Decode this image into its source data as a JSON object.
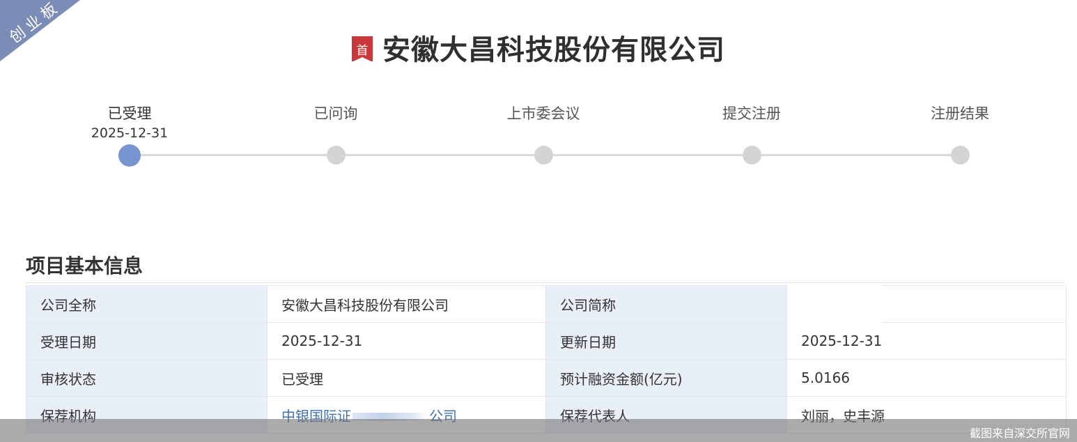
{
  "board_ribbon": "创业板",
  "header": {
    "badge": "首",
    "company_name": "安徽大昌科技股份有限公司"
  },
  "progress": {
    "steps": [
      {
        "label": "已受理",
        "date": "2025-12-31",
        "active": true
      },
      {
        "label": "已问询",
        "date": "",
        "active": false
      },
      {
        "label": "上市委会议",
        "date": "",
        "active": false
      },
      {
        "label": "提交注册",
        "date": "",
        "active": false
      },
      {
        "label": "注册结果",
        "date": "",
        "active": false
      }
    ],
    "active_color": "#7895cf",
    "inactive_color": "#d4d4d4"
  },
  "section": {
    "title": "项目基本信息"
  },
  "info_table": {
    "rows": [
      {
        "label1": "公司全称",
        "value1": "安徽大昌科技股份有限公司",
        "label2": "公司简称",
        "value2": ""
      },
      {
        "label1": "受理日期",
        "value1": "2025-12-31",
        "label2": "更新日期",
        "value2": "2025-12-31"
      },
      {
        "label1": "审核状态",
        "value1": "已受理",
        "label2": "预计融资金额(亿元)",
        "value2": "5.0166"
      },
      {
        "label1": "保荐机构",
        "value1_start": "中银国际证",
        "value1_end": "公司",
        "label2": "保荐代表人",
        "value2": "刘丽，史丰源"
      }
    ],
    "label_bg": "#e9eff8",
    "link_color": "#3c6fb5"
  },
  "watermark": "截图来自深交所官网"
}
